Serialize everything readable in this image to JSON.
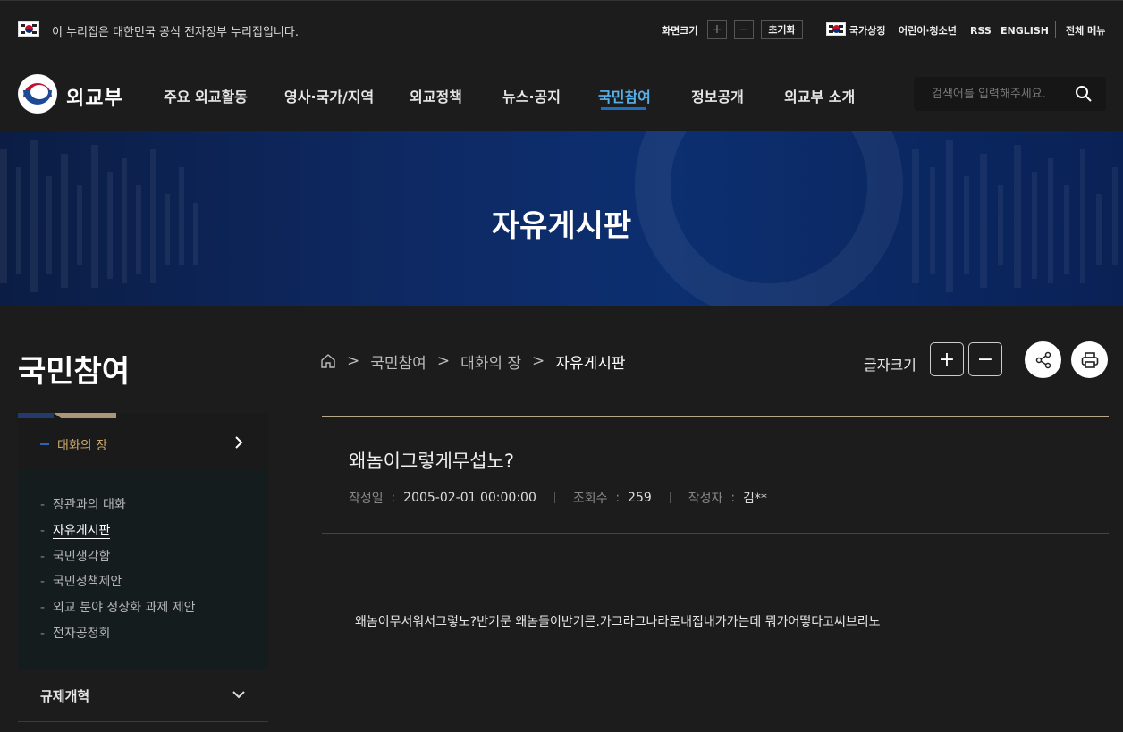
{
  "topbar": {
    "notice": "이 누리집은 대한민국 공식 전자정부 누리집입니다.",
    "screen_size_label": "화면크기",
    "plus": "+",
    "minus": "−",
    "reset": "초기화",
    "links": [
      "국가상징",
      "어린이·청소년",
      "RSS",
      "ENGLISH"
    ],
    "all_menu": "전체 메뉴"
  },
  "header": {
    "logo_text": "외교부",
    "nav": [
      "주요 외교활동",
      "영사·국가/지역",
      "외교정책",
      "뉴스·공지",
      "국민참여",
      "정보공개",
      "외교부 소개"
    ],
    "active_nav": "국민참여",
    "search_placeholder": "검색어를 입력해주세요."
  },
  "banner": {
    "title": "자유게시판"
  },
  "sidebar": {
    "title": "국민참여",
    "section": "대화의 장",
    "items": [
      "장관과의 대화",
      "자유게시판",
      "국민생각함",
      "국민정책제안",
      "외교 분야 정상화 과제 제안",
      "전자공청회"
    ],
    "active_item": "자유게시판",
    "next_section": "규제개혁"
  },
  "breadcrumb": {
    "items": [
      "국민참여",
      "대화의 장",
      "자유게시판"
    ]
  },
  "tools": {
    "font_size_label": "글자크기",
    "plus": "+",
    "minus": "−"
  },
  "article": {
    "title": "왜놈이그렇게무섭노?",
    "date_label": "작성일",
    "date": "2005-02-01 00:00:00",
    "views_label": "조회수",
    "views": "259",
    "author_label": "작성자",
    "author": "김**",
    "separator": ":",
    "body": "왜놈이무서워서그렇노?반기문 왜놈들이반기믄.가그라그나라로내집내가가는데 뭐가어떻다고씨브리노"
  },
  "colors": {
    "background": "#1c1c1c",
    "accent_blue": "#5ab0e8",
    "banner_blue": "#0e2a66",
    "gold": "#c9a869"
  }
}
